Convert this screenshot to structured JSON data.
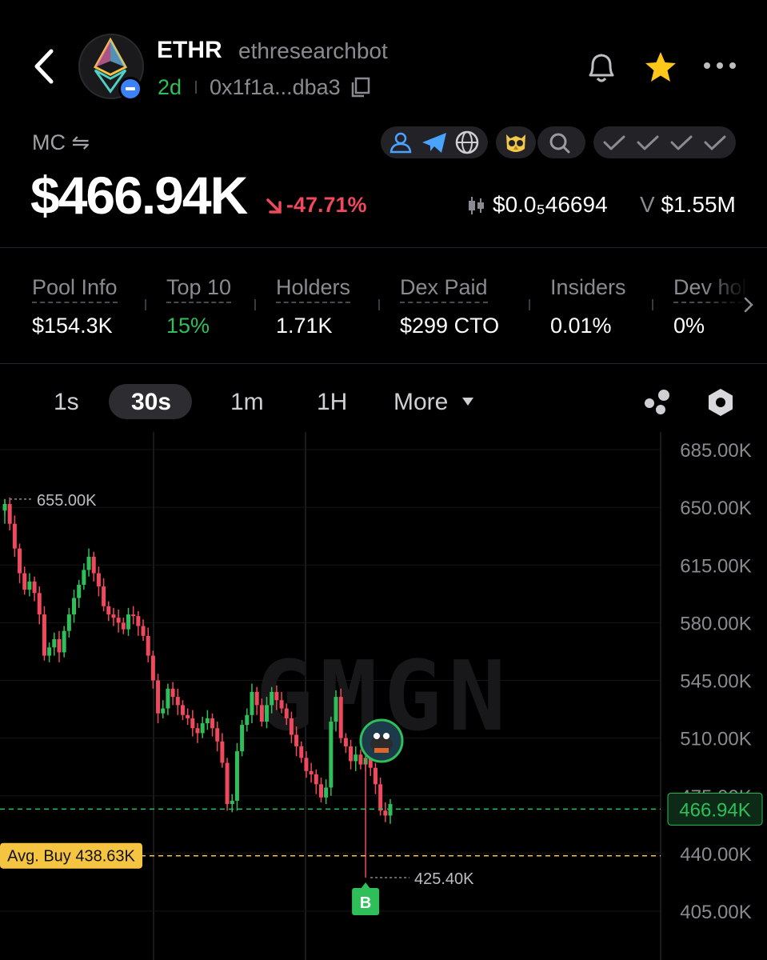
{
  "header": {
    "token_name": "ETHR",
    "handle": "ethresearchbot",
    "age": "2d",
    "address": "0x1f1a...dba3"
  },
  "market": {
    "mc_label": "MC ⇋",
    "market_cap": "$466.94K",
    "change": "-47.71%",
    "price": "$0.0₅46694",
    "volume_prefix": "V",
    "volume": "$1.55M"
  },
  "stats": [
    {
      "label": "Pool Info",
      "value": "$154.3K"
    },
    {
      "label": "Top 10",
      "value": "15%"
    },
    {
      "label": "Holders",
      "value": "1.71K"
    },
    {
      "label": "Dex Paid",
      "value": "$299 CTO"
    },
    {
      "label": "Insiders",
      "value": "0.01%"
    },
    {
      "label": "Dev hold",
      "value": "0%"
    }
  ],
  "timeframes": {
    "items": [
      "1s",
      "30s",
      "1m",
      "1H"
    ],
    "active": "30s",
    "more_label": "More"
  },
  "colors": {
    "up": "#2fbf5a",
    "down": "#f0485c",
    "avg_buy": "#f5c542",
    "current": "#2fbf5a"
  },
  "chart_data": {
    "type": "candlestick",
    "y_axis_ticks": [
      "685.00K",
      "650.00K",
      "615.00K",
      "580.00K",
      "545.00K",
      "510.00K",
      "475.00K",
      "440.00K",
      "405.00K"
    ],
    "ylim": [
      405,
      685
    ],
    "unit": "K",
    "watermark": "GMGN",
    "high_label": "655.00K",
    "low_label": "425.40K",
    "current_label": "466.94K",
    "current_value": 466.94,
    "avg_buy_label": "Avg. Buy 438.63K",
    "avg_buy_value": 438.63,
    "buy_marker_label": "B",
    "close_values": [
      652,
      640,
      625,
      610,
      600,
      605,
      598,
      585,
      560,
      565,
      570,
      562,
      575,
      585,
      595,
      603,
      612,
      620,
      610,
      602,
      590,
      585,
      583,
      580,
      576,
      585,
      584,
      578,
      572,
      560,
      545,
      525,
      528,
      540,
      535,
      530,
      524,
      522,
      516,
      513,
      519,
      522,
      516,
      508,
      495,
      470,
      472,
      502,
      518,
      524,
      538,
      530,
      520,
      530,
      538,
      533,
      528,
      522,
      512,
      505,
      498,
      490,
      488,
      482,
      474,
      480,
      520,
      535,
      510,
      505,
      496,
      500,
      494,
      498,
      492,
      482,
      466,
      463,
      470
    ]
  }
}
